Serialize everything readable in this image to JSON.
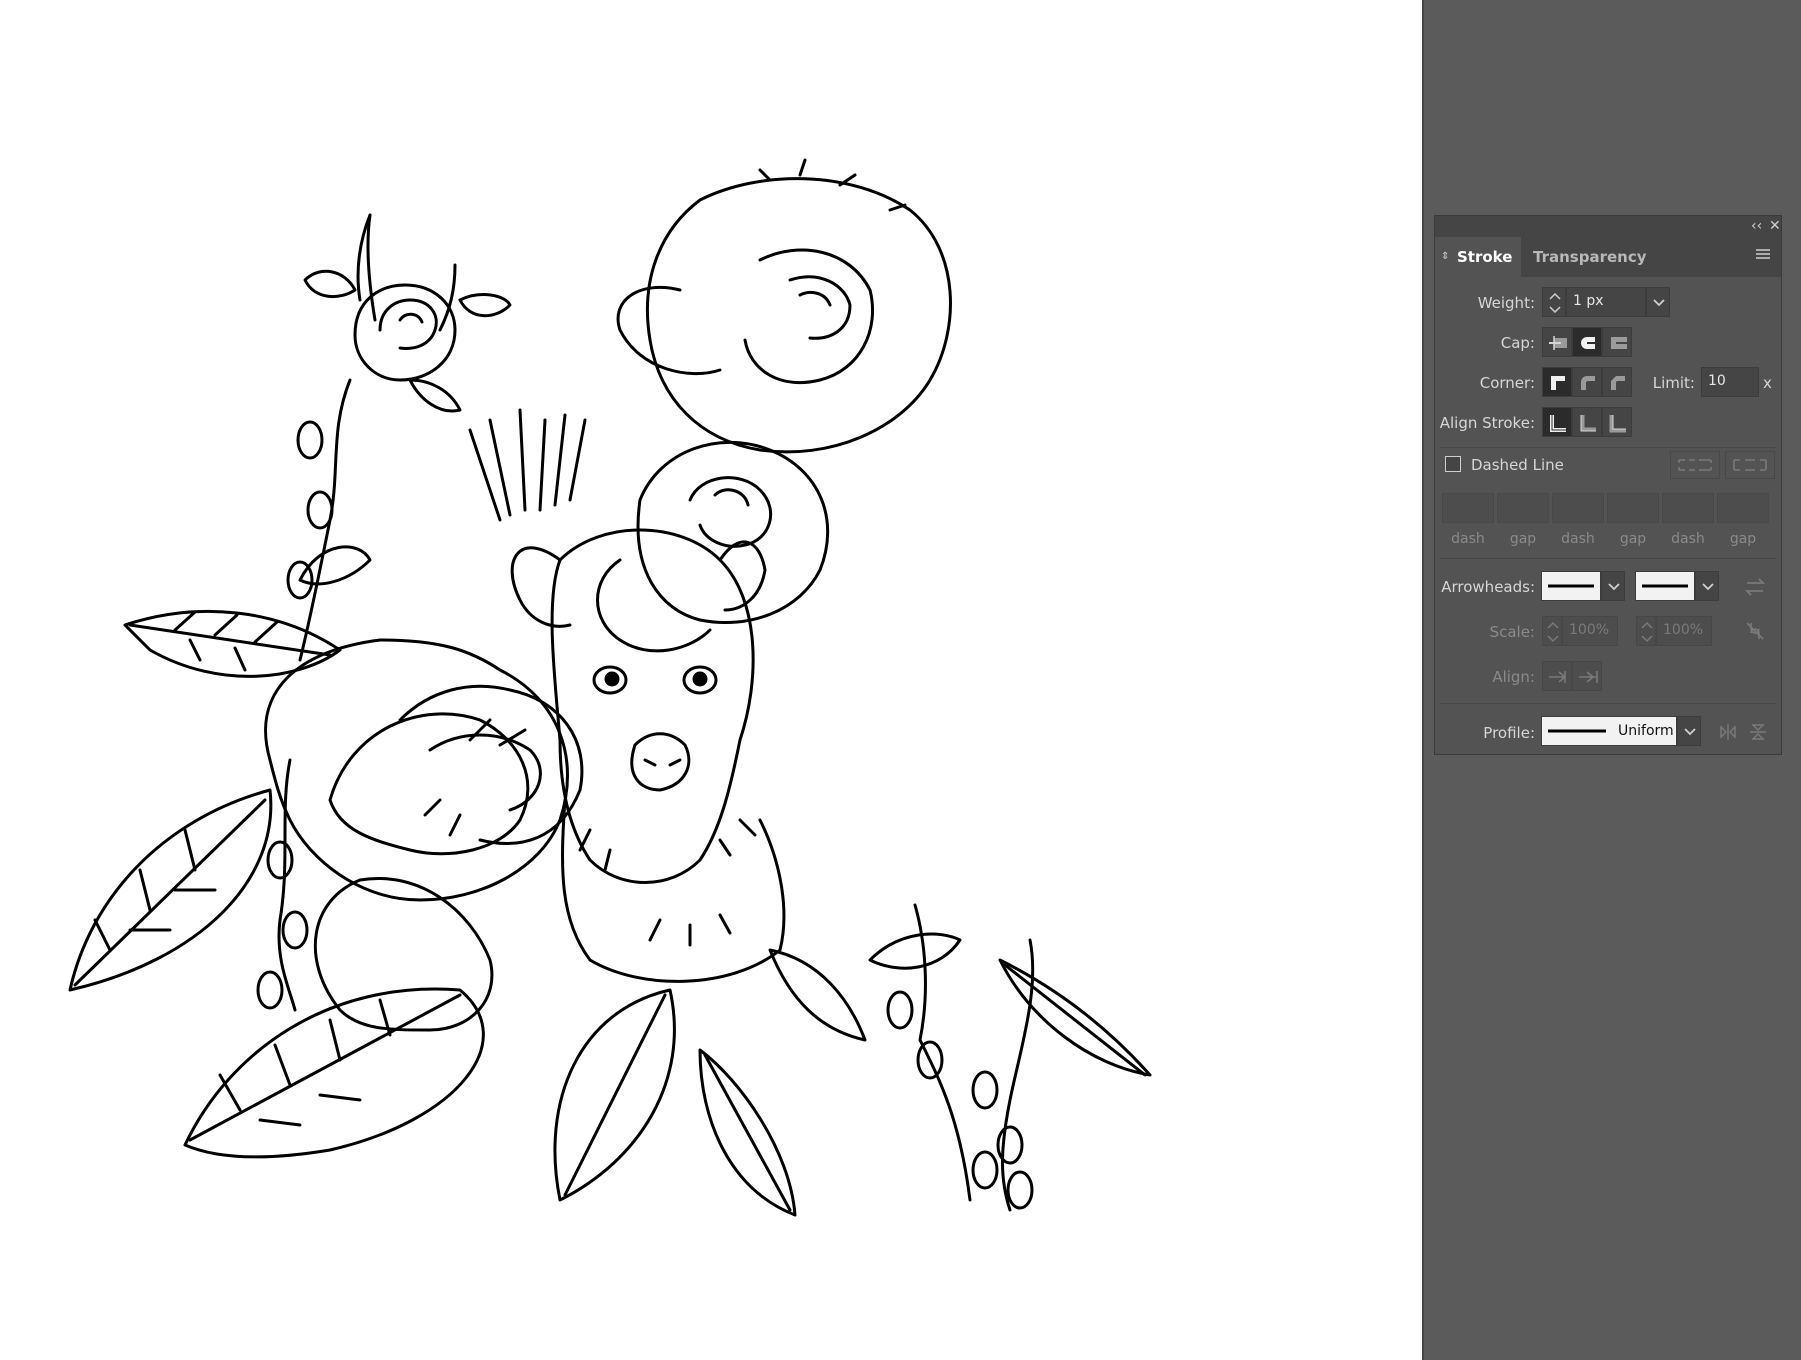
{
  "panel": {
    "tabs": [
      {
        "label": "Stroke",
        "active": true
      },
      {
        "label": "Transparency",
        "active": false
      }
    ],
    "collapse_icon": "double-chevron-left-icon",
    "close_icon": "close-icon",
    "menu_icon": "hamburger-menu-icon",
    "weight": {
      "label": "Weight:",
      "value": "1 px"
    },
    "cap": {
      "label": "Cap:",
      "options": [
        "butt-cap",
        "round-cap",
        "projecting-cap"
      ],
      "selected": 1
    },
    "corner": {
      "label": "Corner:",
      "options": [
        "miter-join",
        "round-join",
        "bevel-join"
      ],
      "selected": 0
    },
    "limit": {
      "label": "Limit:",
      "value": "10",
      "unit": "x"
    },
    "align_stroke": {
      "label": "Align Stroke:",
      "options": [
        "center",
        "inside",
        "outside"
      ],
      "selected": 0
    },
    "dashed_line": {
      "label": "Dashed Line",
      "checked": false
    },
    "dash_fields": [
      "dash",
      "gap",
      "dash",
      "gap",
      "dash",
      "gap"
    ],
    "arrowheads": {
      "label": "Arrowheads:"
    },
    "scale": {
      "label": "Scale:",
      "start": "100%",
      "end": "100%"
    },
    "align": {
      "label": "Align:"
    },
    "profile": {
      "label": "Profile:",
      "value": "Uniform"
    }
  },
  "colors": {
    "dock_bg": "#5b5b5b",
    "panel_bg": "#535353",
    "panel_header": "#454545",
    "canvas_bg": "#ffffff"
  }
}
